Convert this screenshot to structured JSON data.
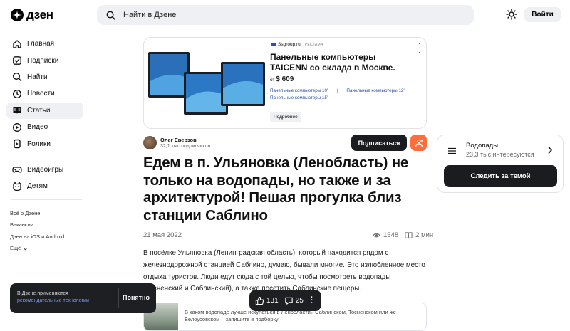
{
  "header": {
    "logo_text": "дзен",
    "search_placeholder": "Найти в Дзене",
    "login_label": "Войти"
  },
  "sidebar": {
    "items": [
      {
        "label": "Главная",
        "icon": "home-icon"
      },
      {
        "label": "Подписки",
        "icon": "subscriptions-icon"
      },
      {
        "label": "Найти",
        "icon": "search-icon"
      },
      {
        "label": "Новости",
        "icon": "news-icon"
      },
      {
        "label": "Статьи",
        "icon": "articles-icon",
        "active": true
      },
      {
        "label": "Видео",
        "icon": "video-icon"
      },
      {
        "label": "Ролики",
        "icon": "shorts-icon"
      }
    ],
    "extra_items": [
      {
        "label": "Видеоигры",
        "icon": "gamepad-icon"
      },
      {
        "label": "Детям",
        "icon": "kids-icon"
      }
    ],
    "footer": [
      "Всё о Дзене",
      "Вакансии",
      "Дзен на iOS и Android",
      "Ещё"
    ]
  },
  "ad": {
    "source": "Ssgroup.ru",
    "label": "РЕКЛАМА",
    "title": "Панельные компьютеры TAICENN со склада в Москве.",
    "price_prefix": "от",
    "price": "$ 609",
    "link1": "Панельные компьютеры 10\"",
    "link_sep": "|",
    "link2": "Панельные компьютеры 12\"",
    "link3": "Панельные компьютеры 15\"",
    "button": "Подробнее"
  },
  "article": {
    "author_name": "Олег Еверзов",
    "author_subs": "32,1 тыс подписчиков",
    "subscribe_label": "Подписаться",
    "title": "Едем в п. Ульяновка (Ленобласть) не только на водопады, но также и за архитектурой! Пешая прогулка близ станции Саблино",
    "date": "21 мая 2022",
    "views": "1548",
    "read_time": "2 мин",
    "body": "В посёлке Ульяновка (Ленинградская область), который находится рядом с железнодорожной станцией Саблино, думаю, бывали многие. Это излюбленное место отдыха туристов. Люди едут сюда с той целью, чтобы посмотреть водопады (Тосненский и Саблинский), а также посетить Саблинские пещеры.",
    "related_text": "В каком водопаде лучше искупаться в Ленобласти? Саблинском, Тосненском или же Белоусовском – запишите в подборку!"
  },
  "topic": {
    "name": "Водопады",
    "count": "23,3 тыс интересуются",
    "follow_label": "Следить за темой"
  },
  "cookie": {
    "text": "В Дзене применяются",
    "link": "рекомендательные технологии",
    "ok_label": "Понятно"
  },
  "reactions": {
    "likes": "131",
    "comments": "25"
  }
}
